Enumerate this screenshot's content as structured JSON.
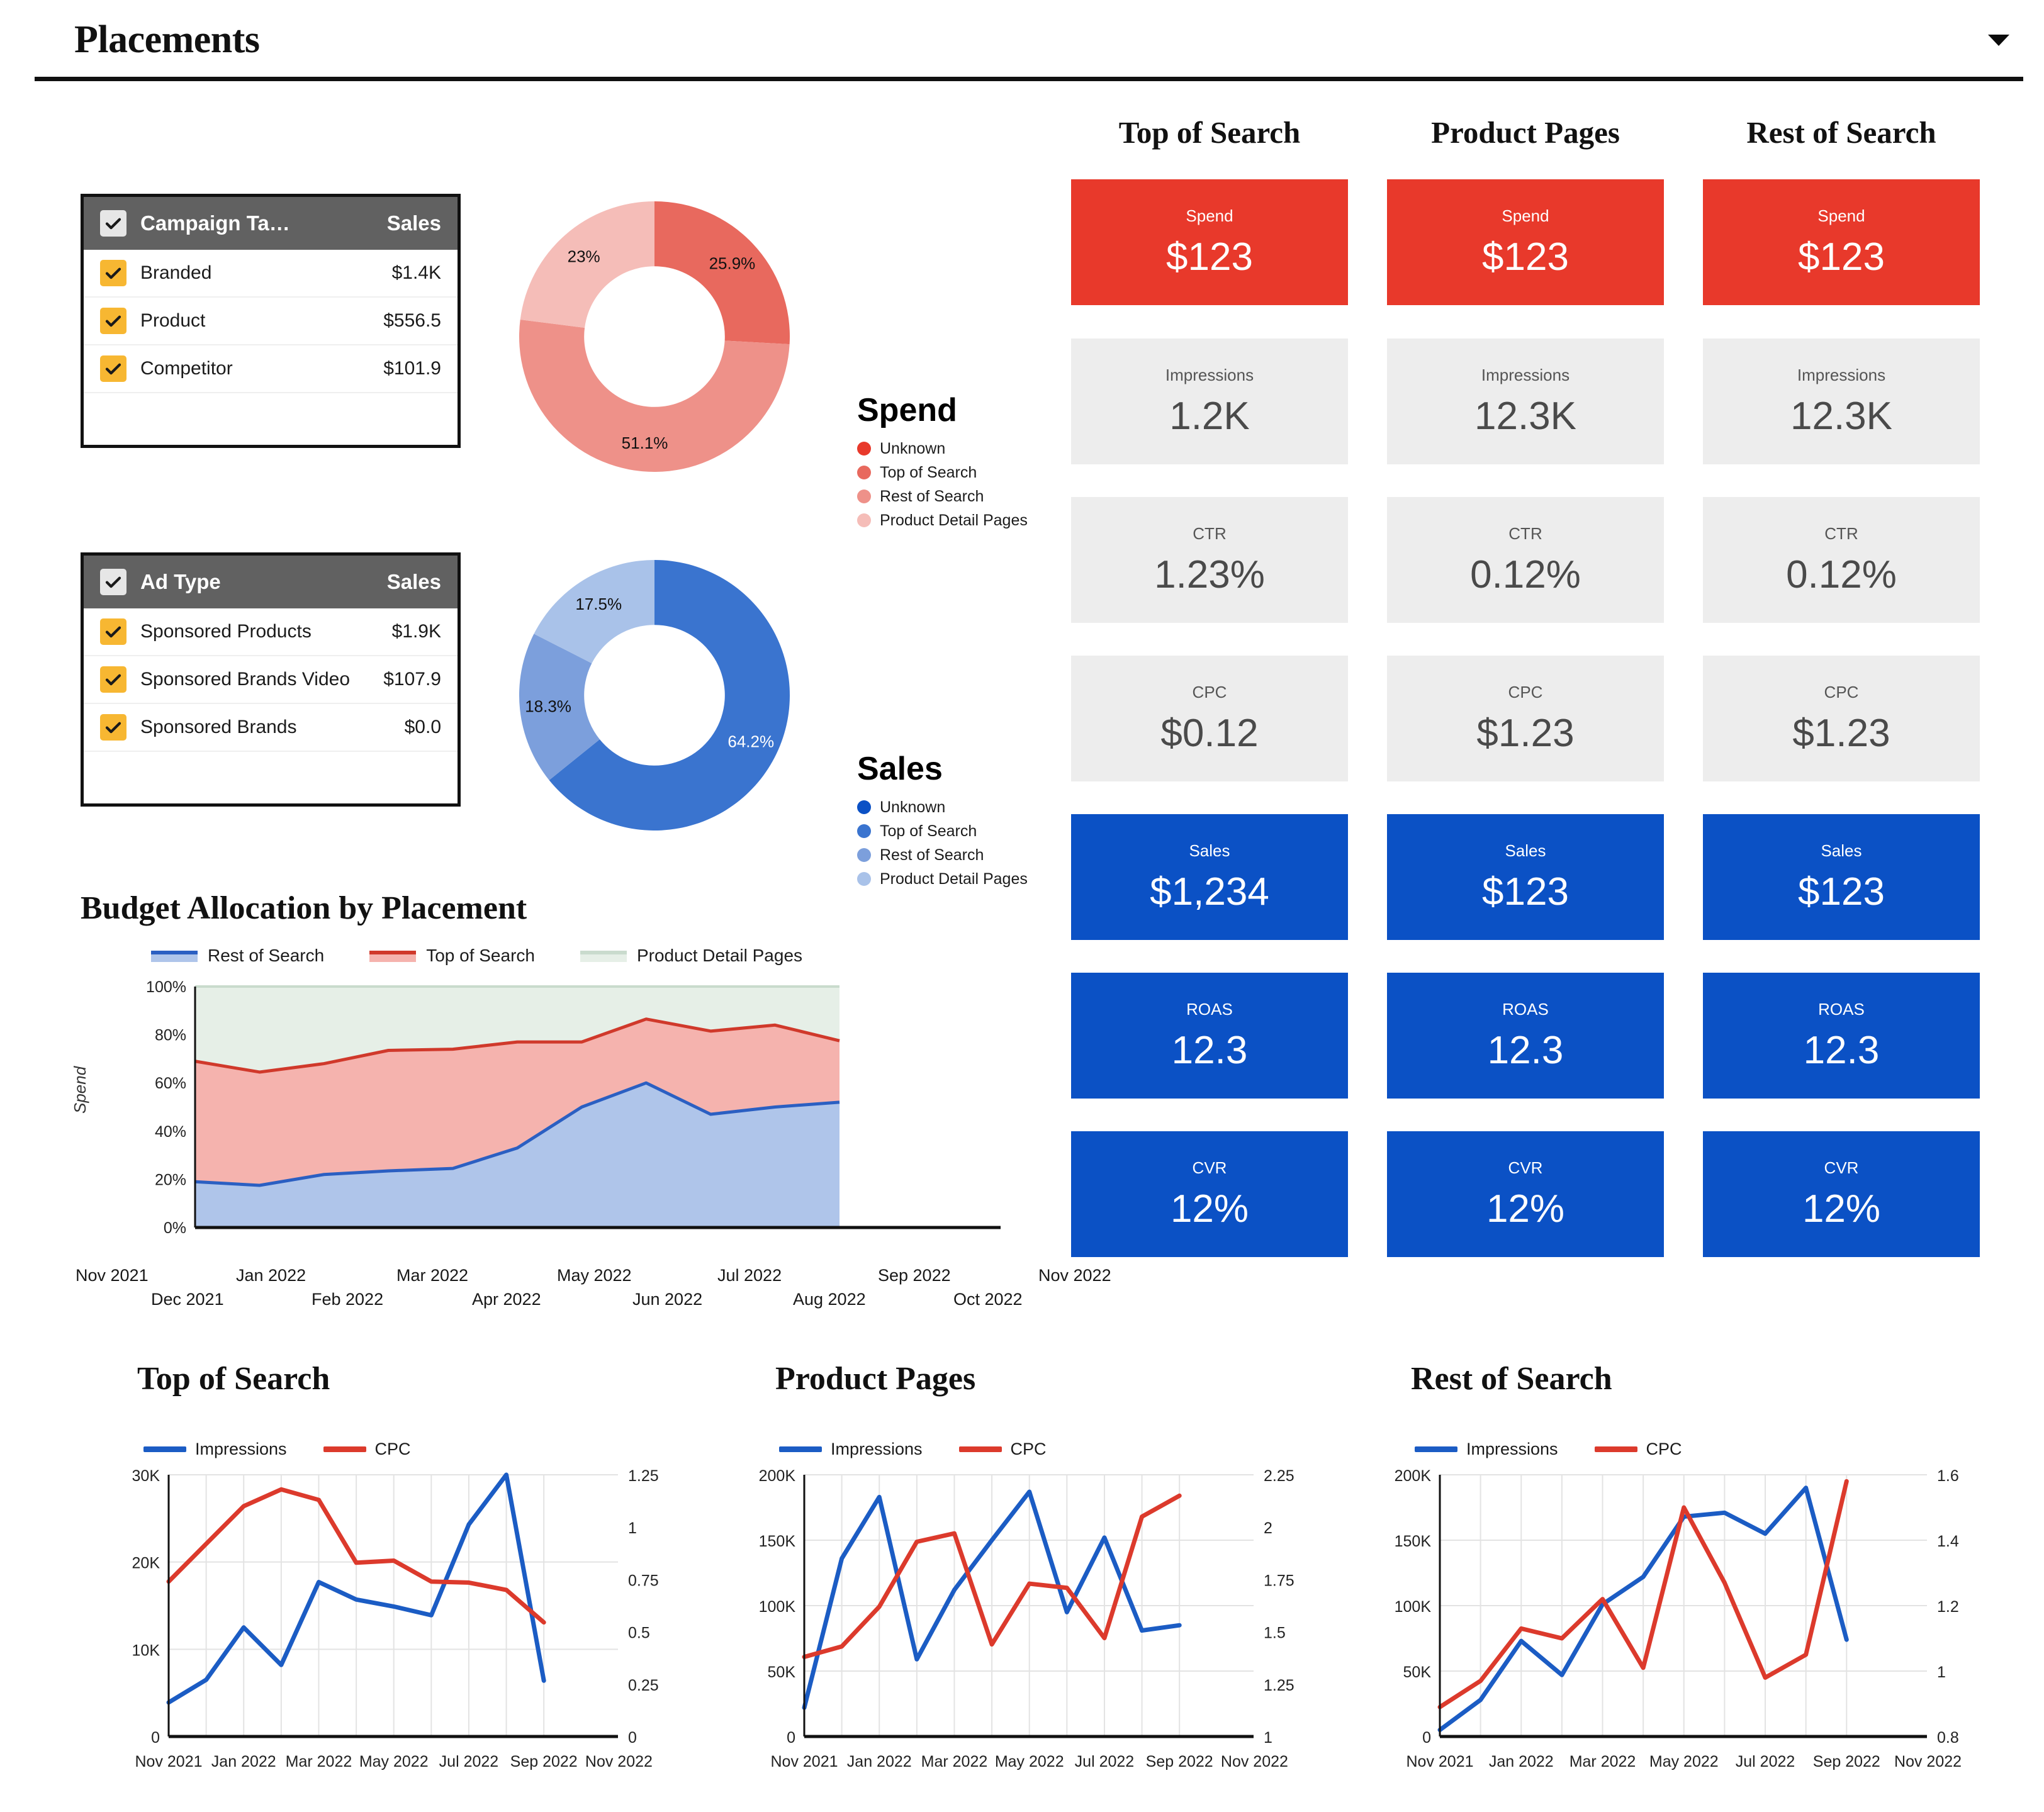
{
  "header": {
    "title": "Placements",
    "dropdown_icon": "chevron-down-icon"
  },
  "filters": [
    {
      "name": "campaign-target",
      "header": {
        "label": "Campaign Ta…",
        "value": "Sales"
      },
      "rows": [
        {
          "label": "Branded",
          "value": "$1.4K",
          "checked": true
        },
        {
          "label": "Product",
          "value": "$556.5",
          "checked": true
        },
        {
          "label": "Competitor",
          "value": "$101.9",
          "checked": true
        }
      ]
    },
    {
      "name": "ad-type",
      "header": {
        "label": "Ad Type",
        "value": "Sales"
      },
      "rows": [
        {
          "label": "Sponsored Products",
          "value": "$1.9K",
          "checked": true
        },
        {
          "label": "Sponsored Brands Video",
          "value": "$107.9",
          "checked": true
        },
        {
          "label": "Sponsored Brands",
          "value": "$0.0",
          "checked": true
        }
      ]
    }
  ],
  "colors": {
    "spend_red": "#E8392B",
    "sales_blue": "#0B51C5",
    "grey_card": "#ededed",
    "header_grey": "#616161",
    "checkbox_amber": "#F7B732",
    "area_blue_line": "#2B5FC2",
    "area_blue_fill": "#AFC5EA",
    "area_red_line": "#D0392B",
    "area_red_fill": "#F5B3AE",
    "area_green_line": "#C9DBCD",
    "area_green_fill": "#E6EFE7",
    "line_blue": "#1B5CC4",
    "line_red": "#DC3A2C"
  },
  "donuts": [
    {
      "name": "spend-donut",
      "title": "Spend",
      "legend": [
        {
          "label": "Unknown",
          "color": "#E8392B"
        },
        {
          "label": "Top of Search",
          "color": "#E8695E"
        },
        {
          "label": "Rest of Search",
          "color": "#EE9189"
        },
        {
          "label": "Product Detail Pages",
          "color": "#F5BDB8"
        }
      ],
      "chart_data": {
        "type": "pie",
        "title": "Spend",
        "labels": [
          "Top of Search",
          "Rest of Search",
          "Product Detail Pages"
        ],
        "values": [
          25.9,
          51.1,
          23.0
        ],
        "value_labels": [
          "25.9%",
          "51.1%",
          "23%"
        ],
        "colors": [
          "#E8695E",
          "#EE9189",
          "#F5BDB8"
        ],
        "legend_position": "right",
        "hole": 0.52
      }
    },
    {
      "name": "sales-donut",
      "title": "Sales",
      "legend": [
        {
          "label": "Unknown",
          "color": "#0B51C5"
        },
        {
          "label": "Top of Search",
          "color": "#3A74CF"
        },
        {
          "label": "Rest of Search",
          "color": "#7C9FDC"
        },
        {
          "label": "Product Detail Pages",
          "color": "#A9C2E9"
        }
      ],
      "chart_data": {
        "type": "pie",
        "title": "Sales",
        "labels": [
          "Top of Search",
          "Rest of Search",
          "Product Detail Pages"
        ],
        "values": [
          64.2,
          18.3,
          17.5
        ],
        "value_labels": [
          "64.2%",
          "18.3%",
          "17.5%"
        ],
        "colors": [
          "#3A74CF",
          "#7C9FDC",
          "#A9C2E9"
        ],
        "legend_position": "right",
        "hole": 0.52
      }
    }
  ],
  "kpi_columns": [
    {
      "title": "Top of Search",
      "metrics": [
        {
          "label": "Spend",
          "value": "$123",
          "style": "red"
        },
        {
          "label": "Impressions",
          "value": "1.2K",
          "style": "grey"
        },
        {
          "label": "CTR",
          "value": "1.23%",
          "style": "grey"
        },
        {
          "label": "CPC",
          "value": "$0.12",
          "style": "grey"
        },
        {
          "label": "Sales",
          "value": "$1,234",
          "style": "blue"
        },
        {
          "label": "ROAS",
          "value": "12.3",
          "style": "blue"
        },
        {
          "label": "CVR",
          "value": "12%",
          "style": "blue"
        }
      ]
    },
    {
      "title": "Product Pages",
      "metrics": [
        {
          "label": "Spend",
          "value": "$123",
          "style": "red"
        },
        {
          "label": "Impressions",
          "value": "12.3K",
          "style": "grey"
        },
        {
          "label": "CTR",
          "value": "0.12%",
          "style": "grey"
        },
        {
          "label": "CPC",
          "value": "$1.23",
          "style": "grey"
        },
        {
          "label": "Sales",
          "value": "$123",
          "style": "blue"
        },
        {
          "label": "ROAS",
          "value": "12.3",
          "style": "blue"
        },
        {
          "label": "CVR",
          "value": "12%",
          "style": "blue"
        }
      ]
    },
    {
      "title": "Rest of Search",
      "metrics": [
        {
          "label": "Spend",
          "value": "$123",
          "style": "red"
        },
        {
          "label": "Impressions",
          "value": "12.3K",
          "style": "grey"
        },
        {
          "label": "CTR",
          "value": "0.12%",
          "style": "grey"
        },
        {
          "label": "CPC",
          "value": "$1.23",
          "style": "grey"
        },
        {
          "label": "Sales",
          "value": "$123",
          "style": "blue"
        },
        {
          "label": "ROAS",
          "value": "12.3",
          "style": "blue"
        },
        {
          "label": "CVR",
          "value": "12%",
          "style": "blue"
        }
      ]
    }
  ],
  "area_chart": {
    "title": "Budget Allocation by Placement",
    "legend": [
      {
        "label": "Rest of Search",
        "line": "#2B5FC2",
        "fill": "#AFC5EA"
      },
      {
        "label": "Top of Search",
        "line": "#D0392B",
        "fill": "#F5B3AE"
      },
      {
        "label": "Product Detail Pages",
        "line": "#C9DBCD",
        "fill": "#E6EFE7"
      }
    ],
    "chart_data": {
      "type": "area",
      "title": "Budget Allocation by Placement",
      "ylabel": "Spend",
      "xlabel": "",
      "ylim": [
        0,
        100
      ],
      "ytick_labels": [
        "0%",
        "20%",
        "40%",
        "60%",
        "80%",
        "100%"
      ],
      "yticks": [
        0,
        20,
        40,
        60,
        80,
        100
      ],
      "grid": false,
      "stacked": true,
      "legend_position": "top",
      "x": [
        "Nov 2021",
        "Dec 2021",
        "Jan 2022",
        "Feb 2022",
        "Mar 2022",
        "Apr 2022",
        "May 2022",
        "Jun 2022",
        "Jul 2022",
        "Aug 2022",
        "Sep 2022"
      ],
      "xtick_labels_row1": [
        "Nov 2021",
        "Jan 2022",
        "Mar 2022",
        "May 2022",
        "Jul 2022",
        "Sep 2022",
        "Nov 2022"
      ],
      "xtick_labels_row2": [
        "Dec 2021",
        "Feb 2022",
        "Apr 2022",
        "Jun 2022",
        "Aug 2022",
        "Oct 2022"
      ],
      "series": [
        {
          "name": "Rest of Search",
          "values": [
            19,
            17.5,
            22,
            23.5,
            24.5,
            33,
            50,
            60,
            47,
            50,
            52
          ]
        },
        {
          "name": "Top of Search",
          "values": [
            50,
            47,
            46,
            50,
            49.5,
            44,
            27,
            26.5,
            34.5,
            34,
            25.5
          ]
        },
        {
          "name": "Product Detail Pages",
          "values": [
            31,
            35.5,
            32,
            26.5,
            26,
            23,
            23,
            13.5,
            18.5,
            16,
            22.5
          ]
        }
      ],
      "cumulative_rest_of_search": [
        19,
        17.5,
        22,
        23.5,
        24.5,
        33,
        50,
        60,
        47,
        50,
        52
      ],
      "cumulative_top_of_search": [
        69,
        64.5,
        68,
        73.5,
        74,
        77,
        77,
        86.5,
        81.5,
        84,
        77.5
      ]
    }
  },
  "line_charts": [
    {
      "name": "top-of-search-trend",
      "chart_data": {
        "type": "line",
        "title": "Top of Search",
        "legend": [
          "Impressions",
          "CPC"
        ],
        "legend_position": "top",
        "grid": true,
        "x": [
          "Nov 2021",
          "Dec 2021",
          "Jan 2022",
          "Feb 2022",
          "Mar 2022",
          "Apr 2022",
          "May 2022",
          "Jun 2022",
          "Jul 2022",
          "Aug 2022",
          "Sep 2022"
        ],
        "xtick_labels": [
          "Nov 2021",
          "Jan 2022",
          "Mar 2022",
          "May 2022",
          "Jul 2022",
          "Sep 2022",
          "Nov 2022"
        ],
        "y_left_label": "Impressions",
        "y_left_lim": [
          0,
          30000
        ],
        "y_left_ticks": [
          0,
          10000,
          20000,
          30000
        ],
        "y_left_tick_labels": [
          "0",
          "10K",
          "20K",
          "30K"
        ],
        "y_right_label": "CPC",
        "y_right_lim": [
          0,
          1.25
        ],
        "y_right_ticks": [
          0,
          0.25,
          0.5,
          0.75,
          1,
          1.25
        ],
        "y_right_tick_labels": [
          "0",
          "0.25",
          "0.5",
          "0.75",
          "1",
          "1.25"
        ],
        "series": [
          {
            "name": "Impressions",
            "color": "#1B5CC4",
            "axis": "left",
            "values": [
              3900,
              6500,
              12500,
              8200,
              17700,
              15700,
              14900,
              13900,
              24300,
              30000,
              6400
            ]
          },
          {
            "name": "CPC",
            "color": "#DC3A2C",
            "axis": "right",
            "values": [
              0.74,
              0.92,
              1.1,
              1.18,
              1.13,
              0.83,
              0.84,
              0.74,
              0.735,
              0.7,
              0.545
            ]
          }
        ]
      }
    },
    {
      "name": "product-pages-trend",
      "chart_data": {
        "type": "line",
        "title": "Product Pages",
        "legend": [
          "Impressions",
          "CPC"
        ],
        "legend_position": "top",
        "grid": true,
        "x": [
          "Nov 2021",
          "Dec 2021",
          "Jan 2022",
          "Feb 2022",
          "Mar 2022",
          "Apr 2022",
          "May 2022",
          "Jun 2022",
          "Jul 2022",
          "Aug 2022",
          "Sep 2022"
        ],
        "xtick_labels": [
          "Nov 2021",
          "Jan 2022",
          "Mar 2022",
          "May 2022",
          "Jul 2022",
          "Sep 2022",
          "Nov 2022"
        ],
        "y_left_label": "Impressions",
        "y_left_lim": [
          0,
          200000
        ],
        "y_left_ticks": [
          0,
          50000,
          100000,
          150000,
          200000
        ],
        "y_left_tick_labels": [
          "0",
          "50K",
          "100K",
          "150K",
          "200K"
        ],
        "y_right_label": "CPC",
        "y_right_lim": [
          1,
          2.25
        ],
        "y_right_ticks": [
          1,
          1.25,
          1.5,
          1.75,
          2,
          2.25
        ],
        "y_right_tick_labels": [
          "1",
          "1.25",
          "1.5",
          "1.75",
          "2",
          "2.25"
        ],
        "series": [
          {
            "name": "Impressions",
            "color": "#1B5CC4",
            "axis": "left",
            "values": [
              22000,
              136000,
              183000,
              59000,
              112000,
              150000,
              187000,
              95000,
              152000,
              81000,
              85000
            ]
          },
          {
            "name": "CPC",
            "color": "#DC3A2C",
            "axis": "right",
            "values": [
              1.38,
              1.43,
              1.62,
              1.93,
              1.97,
              1.44,
              1.73,
              1.71,
              1.47,
              2.05,
              2.15
            ]
          }
        ]
      }
    },
    {
      "name": "rest-of-search-trend",
      "chart_data": {
        "type": "line",
        "title": "Rest of Search",
        "legend": [
          "Impressions",
          "CPC"
        ],
        "legend_position": "top",
        "grid": true,
        "x": [
          "Nov 2021",
          "Dec 2021",
          "Jan 2022",
          "Feb 2022",
          "Mar 2022",
          "Apr 2022",
          "May 2022",
          "Jun 2022",
          "Jul 2022",
          "Aug 2022",
          "Sep 2022"
        ],
        "xtick_labels": [
          "Nov 2021",
          "Jan 2022",
          "Mar 2022",
          "May 2022",
          "Jul 2022",
          "Sep 2022",
          "Nov 2022"
        ],
        "y_left_label": "Impressions",
        "y_left_lim": [
          0,
          200000
        ],
        "y_left_ticks": [
          0,
          50000,
          100000,
          150000,
          200000
        ],
        "y_left_tick_labels": [
          "0",
          "50K",
          "100K",
          "150K",
          "200K"
        ],
        "y_right_label": "CPC",
        "y_right_lim": [
          0.8,
          1.6
        ],
        "y_right_ticks": [
          0.8,
          1.0,
          1.2,
          1.4,
          1.6
        ],
        "y_right_tick_labels": [
          "0.8",
          "1",
          "1.2",
          "1.4",
          "1.6"
        ],
        "series": [
          {
            "name": "Impressions",
            "color": "#1B5CC4",
            "axis": "left",
            "values": [
              5000,
              28000,
              73000,
              47000,
              101000,
              122000,
              168000,
              171000,
              155000,
              190000,
              74000
            ]
          },
          {
            "name": "CPC",
            "color": "#DC3A2C",
            "axis": "right",
            "values": [
              0.89,
              0.97,
              1.13,
              1.1,
              1.22,
              1.01,
              1.5,
              1.27,
              0.98,
              1.05,
              1.58
            ]
          }
        ]
      }
    }
  ]
}
